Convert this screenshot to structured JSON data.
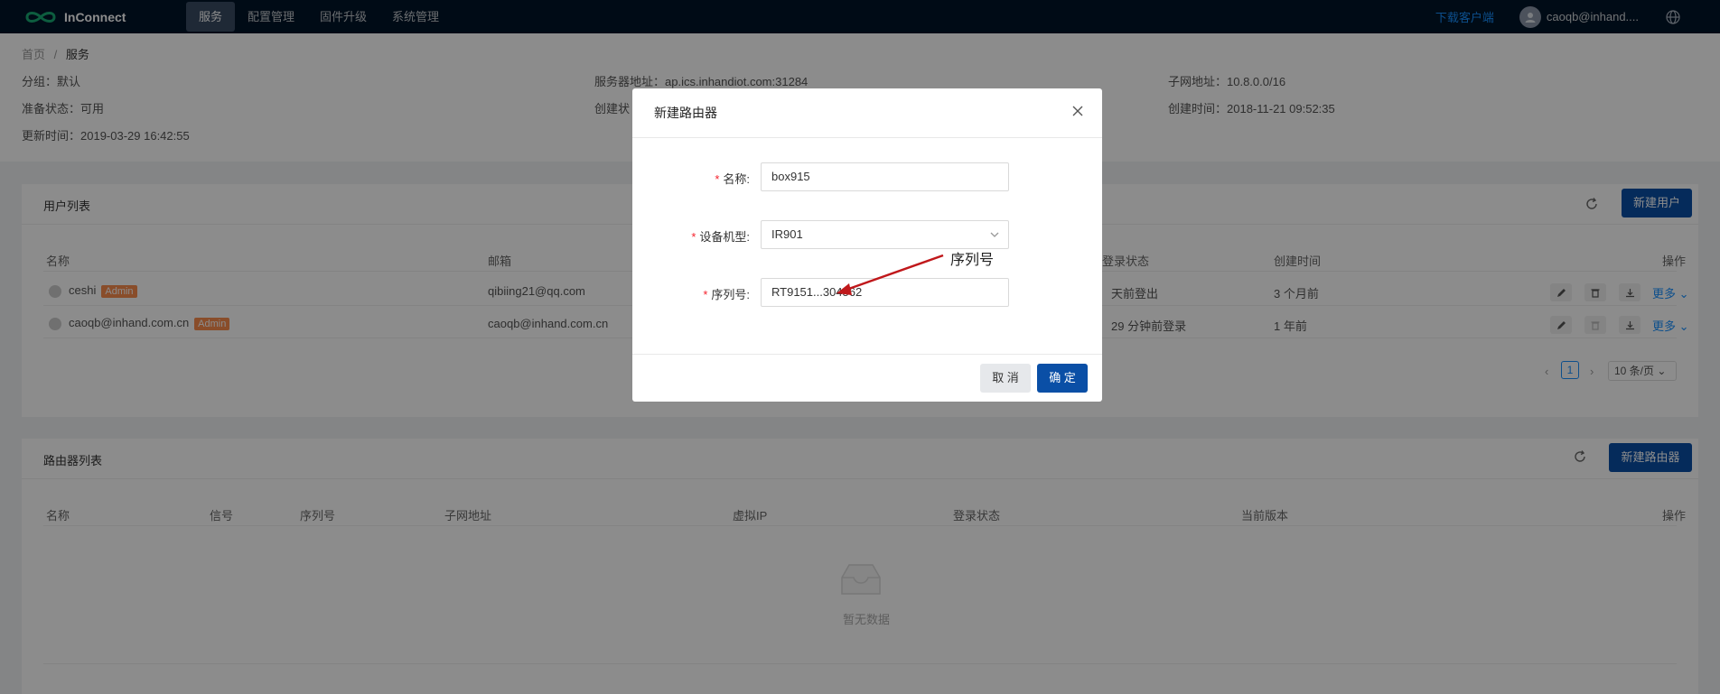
{
  "app": {
    "name": "InConnect"
  },
  "nav": {
    "items": [
      {
        "label": "服务",
        "active": true
      },
      {
        "label": "配置管理"
      },
      {
        "label": "固件升级"
      },
      {
        "label": "系统管理"
      }
    ],
    "download_label": "下载客户端",
    "user_name": "caoqb@inhand...."
  },
  "breadcrumb": {
    "home": "首页",
    "sep": "/",
    "current": "服务"
  },
  "service_info": {
    "group": "分组：默认",
    "server": "服务器地址：ap.ics.inhandiot.com:31284",
    "subnet": "子网地址：10.8.0.0/16",
    "ready": "准备状态：可用",
    "created_partial": "创建状",
    "created": "创建时间：2018-11-21 09:52:35",
    "updated": "更新时间：2019-03-29 16:42:55"
  },
  "user_list": {
    "title": "用户列表",
    "new_button": "新建用户",
    "headers": {
      "name": "名称",
      "email": "邮箱",
      "login": "登录状态",
      "created": "创建时间",
      "ops": "操作"
    },
    "rows": [
      {
        "name": "ceshi",
        "badge": "Admin",
        "email": "qibiing21@qq.com",
        "login": "天前登出",
        "created": "3 个月前",
        "more": "更多"
      },
      {
        "name": "caoqb@inhand.com.cn",
        "badge": "Admin",
        "email": "caoqb@inhand.com.cn",
        "login": "29 分钟前登录",
        "created": "1 年前",
        "more": "更多"
      }
    ],
    "pager": {
      "page": "1",
      "size": "10 条/页"
    }
  },
  "router_list": {
    "title": "路由器列表",
    "new_button": "新建路由器",
    "headers": {
      "name": "名称",
      "signal": "信号",
      "serial": "序列号",
      "subnet": "子网地址",
      "vip": "虚拟IP",
      "login": "登录状态",
      "version": "当前版本",
      "ops": "操作"
    },
    "empty": "暂无数据"
  },
  "modal": {
    "title": "新建路由器",
    "fields": {
      "name_label": "名称:",
      "name_value": "box915",
      "model_label": "设备机型:",
      "model_value": "IR901",
      "serial_label": "序列号:",
      "serial_value": "RT9151...304562"
    },
    "cancel": "取 消",
    "ok": "确 定"
  },
  "annotation": {
    "text": "序列号",
    "color": "#c0181b"
  },
  "colors": {
    "nav_bg": "#001529",
    "primary": "#0a4fa6",
    "badge": "#fa8c4d"
  }
}
